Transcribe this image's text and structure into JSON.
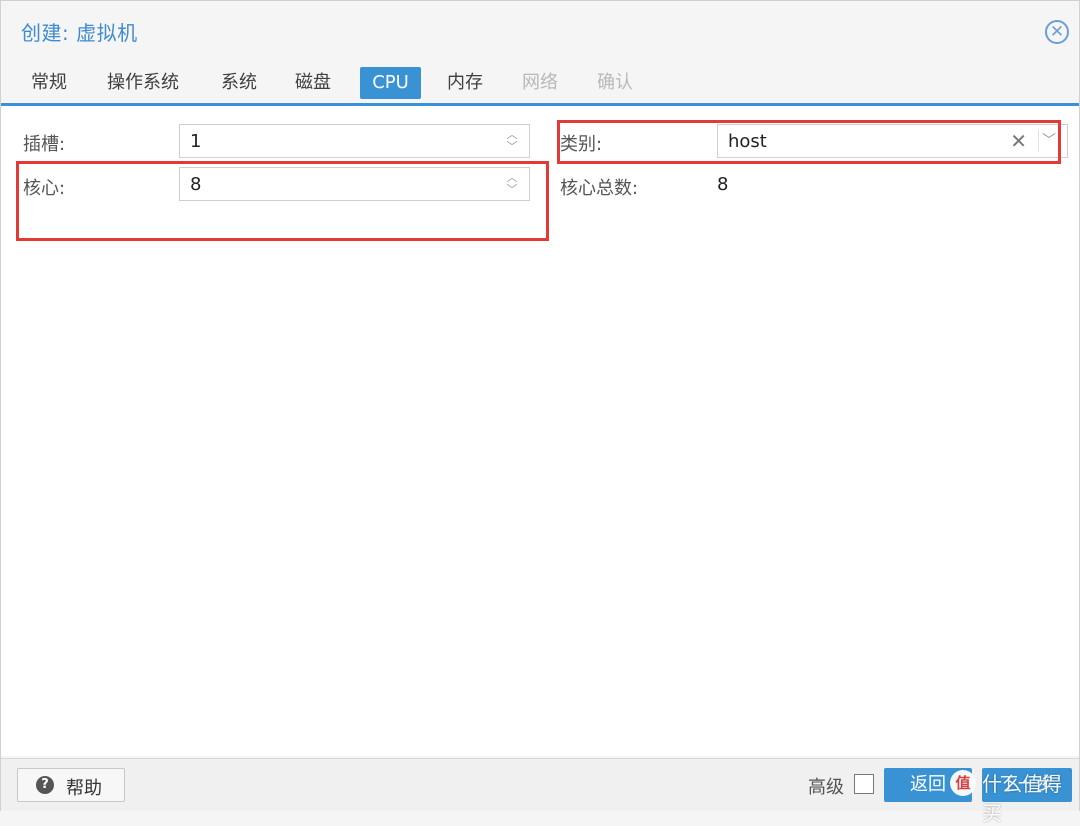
{
  "window": {
    "title": "创建: 虚拟机",
    "close_icon": "close-icon"
  },
  "tabs": [
    {
      "label": "常规",
      "state": "normal"
    },
    {
      "label": "操作系统",
      "state": "normal"
    },
    {
      "label": "系统",
      "state": "normal"
    },
    {
      "label": "磁盘",
      "state": "normal"
    },
    {
      "label": "CPU",
      "state": "active"
    },
    {
      "label": "内存",
      "state": "normal"
    },
    {
      "label": "网络",
      "state": "disabled"
    },
    {
      "label": "确认",
      "state": "disabled"
    }
  ],
  "form": {
    "sockets": {
      "label": "插槽:",
      "value": "1"
    },
    "cores": {
      "label": "核心:",
      "value": "8"
    },
    "type": {
      "label": "类别:",
      "value": "host"
    },
    "total_cores": {
      "label": "核心总数:",
      "value": "8"
    }
  },
  "footer": {
    "help_label": "帮助",
    "advanced_label": "高级",
    "advanced_checked": false,
    "back_label": "返回",
    "next_label": "下一步"
  },
  "watermark": {
    "text": "什么值得买",
    "badge": "值"
  },
  "colors": {
    "accent": "#3892d4",
    "highlight": "#e53935"
  }
}
